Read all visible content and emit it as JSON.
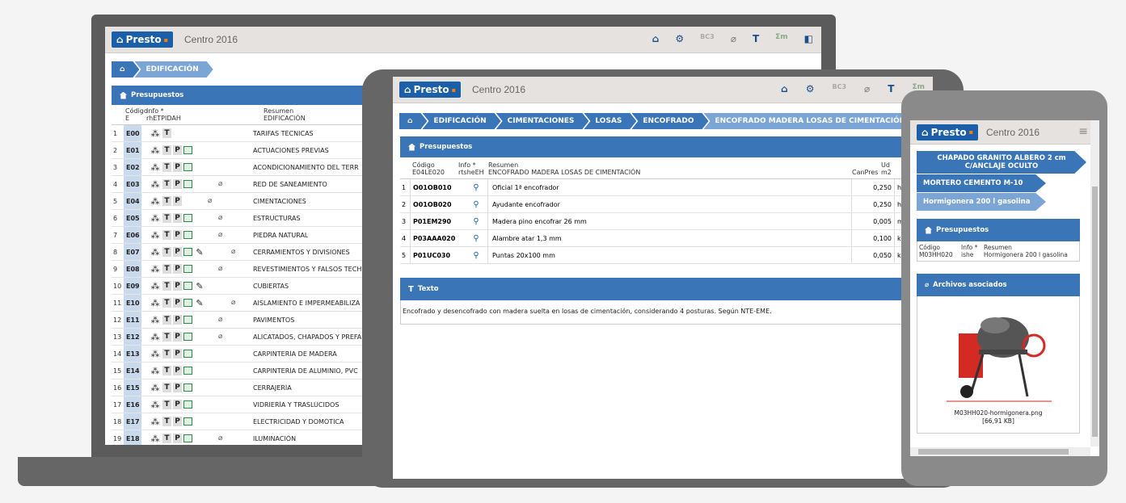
{
  "app": {
    "logo": "Presto",
    "title": "Centro 2016"
  },
  "laptop": {
    "breadcrumb": [
      "EDIFICACIÓN"
    ],
    "panel_title": "Presupuestos",
    "col_headers": {
      "num": "",
      "code": "Código",
      "code_sub": "E",
      "info": "Info *",
      "info_sub": "rhETPIDAH",
      "summary": "Resumen",
      "summary_sub": "EDIFICACIÓN"
    },
    "rows": [
      {
        "n": "1",
        "code": "E00",
        "icons": [
          "tree",
          "T"
        ],
        "clip": false,
        "summary": "TARIFAS TÉCNICAS"
      },
      {
        "n": "2",
        "code": "E01",
        "icons": [
          "tree",
          "T",
          "P",
          "img"
        ],
        "clip": false,
        "summary": "ACTUACIONES PREVIAS"
      },
      {
        "n": "3",
        "code": "E02",
        "icons": [
          "tree",
          "T",
          "P",
          "img"
        ],
        "clip": false,
        "summary": "ACONDICIONAMIENTO DEL TERR"
      },
      {
        "n": "4",
        "code": "E03",
        "icons": [
          "tree",
          "T",
          "P",
          "img"
        ],
        "clip": true,
        "summary": "RED DE SANEAMIENTO"
      },
      {
        "n": "5",
        "code": "E04",
        "icons": [
          "tree",
          "T",
          "P"
        ],
        "clip": true,
        "summary": "CIMENTACIONES"
      },
      {
        "n": "6",
        "code": "E05",
        "icons": [
          "tree",
          "T",
          "P",
          "img"
        ],
        "clip": true,
        "summary": "ESTRUCTURAS"
      },
      {
        "n": "7",
        "code": "E06",
        "icons": [
          "tree",
          "T",
          "P",
          "img"
        ],
        "clip": true,
        "summary": "PIEDRA NATURAL"
      },
      {
        "n": "8",
        "code": "E07",
        "icons": [
          "tree",
          "T",
          "P",
          "img",
          "pen"
        ],
        "clip": true,
        "summary": "CERRAMIENTOS Y DIVISIONES"
      },
      {
        "n": "9",
        "code": "E08",
        "icons": [
          "tree",
          "T",
          "P",
          "img"
        ],
        "clip": true,
        "summary": "REVESTIMIENTOS Y FALSOS TECH"
      },
      {
        "n": "10",
        "code": "E09",
        "icons": [
          "tree",
          "T",
          "P",
          "img",
          "pen"
        ],
        "clip": false,
        "summary": "CUBIERTAS"
      },
      {
        "n": "11",
        "code": "E10",
        "icons": [
          "tree",
          "T",
          "P",
          "img",
          "pen"
        ],
        "clip": true,
        "summary": "AISLAMIENTO E IMPERMEABILIZA"
      },
      {
        "n": "12",
        "code": "E11",
        "icons": [
          "tree",
          "T",
          "P",
          "img"
        ],
        "clip": true,
        "summary": "PAVIMENTOS"
      },
      {
        "n": "13",
        "code": "E12",
        "icons": [
          "tree",
          "T",
          "P",
          "img"
        ],
        "clip": true,
        "summary": "ALICATADOS, CHAPADOS Y PREFA"
      },
      {
        "n": "14",
        "code": "E13",
        "icons": [
          "tree",
          "T",
          "P",
          "img"
        ],
        "clip": false,
        "summary": "CARPINTERÍA DE MADERA"
      },
      {
        "n": "15",
        "code": "E14",
        "icons": [
          "tree",
          "T",
          "P",
          "img"
        ],
        "clip": false,
        "summary": "CARPINTERÍA DE ALUMINIO, PVC"
      },
      {
        "n": "16",
        "code": "E15",
        "icons": [
          "tree",
          "T",
          "P",
          "img"
        ],
        "clip": false,
        "summary": "CERRAJERÍA"
      },
      {
        "n": "17",
        "code": "E16",
        "icons": [
          "tree",
          "T",
          "P",
          "img"
        ],
        "clip": false,
        "summary": "VIDRIERÍA Y TRASLÚCIDOS"
      },
      {
        "n": "18",
        "code": "E17",
        "icons": [
          "tree",
          "T",
          "P",
          "img"
        ],
        "clip": false,
        "summary": "ELECTRICIDAD Y DOMÓTICA"
      },
      {
        "n": "19",
        "code": "E18",
        "icons": [
          "tree",
          "T",
          "P",
          "img"
        ],
        "clip": true,
        "summary": "ILUMINACIÓN"
      }
    ]
  },
  "tablet": {
    "breadcrumb": [
      "EDIFICACIÓN",
      "CIMENTACIONES",
      "LOSAS",
      "ENCOFRADO",
      "ENCOFRADO MADERA LOSAS DE CIMENTACIÓN"
    ],
    "panel_title": "Presupuestos",
    "col_headers": {
      "code": "Código",
      "code_sub": "E04LE020",
      "info": "Info *",
      "info_sub": "rtsheEH",
      "summary": "Resumen",
      "summary_sub": "ENCOFRADO MADERA LOSAS DE CIMENTACIÓN",
      "qty": "CanPres",
      "unit": "Ud",
      "unit_sub": "m2"
    },
    "rows": [
      {
        "n": "1",
        "code": "O01OB010",
        "summary": "Oficial 1ª encofrador",
        "qty": "0,250",
        "unit": "h"
      },
      {
        "n": "2",
        "code": "O01OB020",
        "summary": "Ayudante encofrador",
        "qty": "0,250",
        "unit": "h"
      },
      {
        "n": "3",
        "code": "P01EM290",
        "summary": "Madera pino encofrar 26 mm",
        "qty": "0,005",
        "unit": "m3"
      },
      {
        "n": "4",
        "code": "P03AAA020",
        "summary": "Alambre atar 1,3 mm",
        "qty": "0,100",
        "unit": "kg"
      },
      {
        "n": "5",
        "code": "P01UC030",
        "summary": "Puntas 20x100 mm",
        "qty": "0,050",
        "unit": "kg"
      }
    ],
    "text_panel_title": "Texto",
    "text_body": "Encofrado y desencofrado con madera suelta en losas de cimentación, considerando 4 posturas. Según NTE-EME."
  },
  "phone": {
    "breadcrumb": [
      "CHAPADO GRANITO ALBERO 2 cm C/ANCLAJE OCULTO",
      "MORTERO CEMENTO M-10",
      "Hormigonera 200 l gasolina"
    ],
    "panel_title": "Presupuestos",
    "col_headers": {
      "code": "Código",
      "code_sub": "M03HH020",
      "info": "Info *",
      "info_sub": "ishe",
      "summary": "Resumen",
      "summary_sub": "Hormigonera 200 l gasolina"
    },
    "files_title": "Archivos asociados",
    "file_name": "M03HH020-hormigonera.png",
    "file_size": "[66,91 KB]"
  },
  "colors": {
    "accent": "#3a75b7",
    "brand": "#1a5fa8",
    "code_bg": "#c9d9ee",
    "mixer_red": "#d42a24"
  }
}
